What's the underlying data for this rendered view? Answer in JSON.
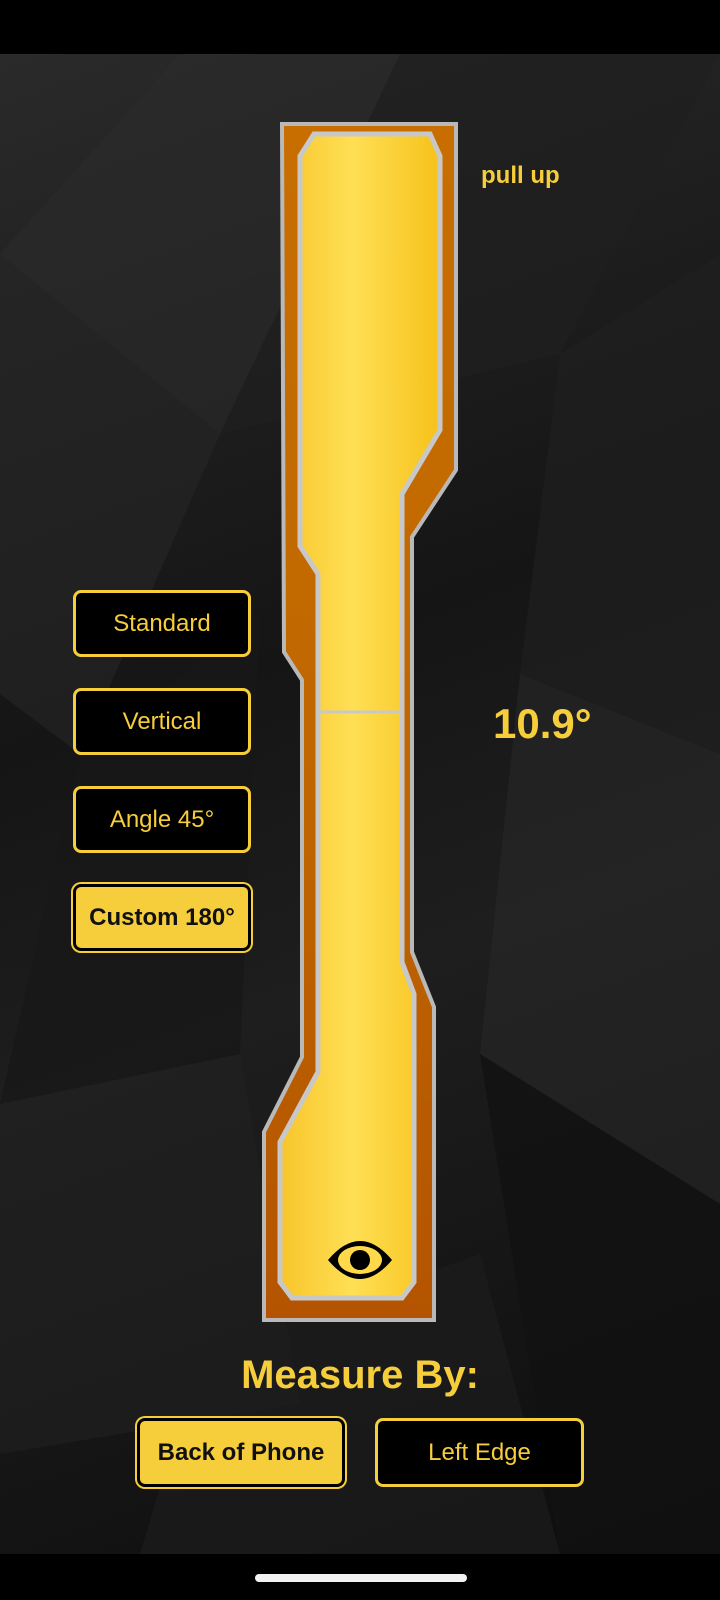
{
  "level": {
    "direction_label": "pull up",
    "angle": "10.9°",
    "eye_icon": "eye-icon"
  },
  "modes": [
    {
      "label": "Standard",
      "active": false
    },
    {
      "label": "Vertical",
      "active": false
    },
    {
      "label": "Angle 45°",
      "active": false
    },
    {
      "label": "Custom 180°",
      "active": true
    }
  ],
  "measure": {
    "title": "Measure By:",
    "options": [
      {
        "label": "Back of Phone",
        "active": true
      },
      {
        "label": "Left Edge",
        "active": false
      }
    ]
  },
  "colors": {
    "accent": "#f6cd3a",
    "tube_outer": "#c46a00",
    "tube_inner": "#ffd94a"
  }
}
